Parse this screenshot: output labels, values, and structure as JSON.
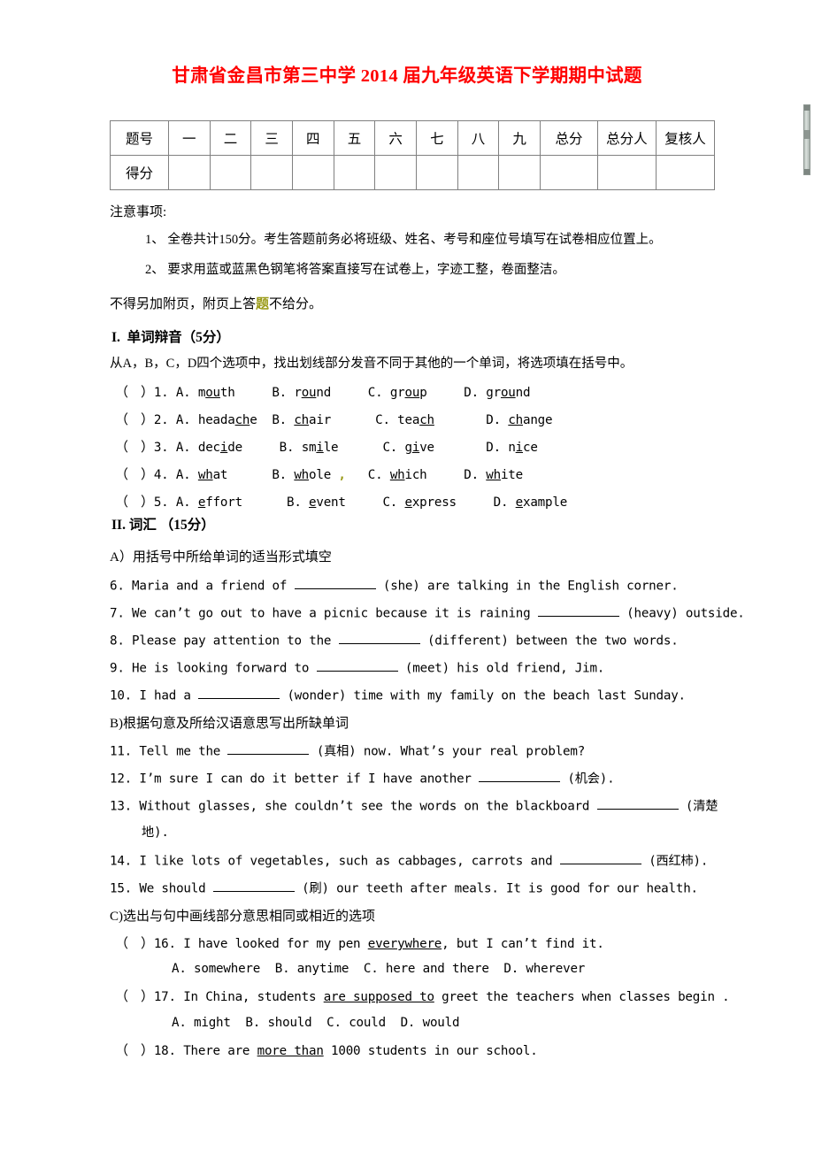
{
  "title": "甘肃省金昌市第三中学 2014 届九年级英语下学期期中试题",
  "score_table": {
    "row_labels": [
      "题号",
      "得分"
    ],
    "columns": [
      "一",
      "二",
      "三",
      "四",
      "五",
      "六",
      "七",
      "八",
      "九",
      "总分",
      "总分人",
      "复核人"
    ]
  },
  "notice": {
    "heading": "注意事项:",
    "item1": "1、 全卷共计150分。考生答题前务必将班级、姓名、考号和座位号填写在试卷相应位置上。",
    "item2": "2、 要求用蓝或蓝黑色钢笔将答案直接写在试卷上，字迹工整，卷面整洁。",
    "footer_a": "不得另加附页，附页上答",
    "footer_mark": "题",
    "footer_b": "不给分。"
  },
  "section1": {
    "heading": "I.  单词辩音（5分）",
    "instruction": "从A，B，C，D四个选项中，找出划线部分发音不同于其他的一个单词，将选项填在括号中。",
    "bracket": "（    ）",
    "questions": [
      {
        "num": "1.",
        "options": [
          {
            "letter": "A.",
            "pre": "m",
            "mid": "ou",
            "post": "th"
          },
          {
            "letter": "B.",
            "pre": "r",
            "mid": "ou",
            "post": "nd"
          },
          {
            "letter": "C.",
            "pre": "gr",
            "mid": "ou",
            "post": "p"
          },
          {
            "letter": "D.",
            "pre": "gr",
            "mid": "ou",
            "post": "nd"
          }
        ]
      },
      {
        "num": "2.",
        "options": [
          {
            "letter": "A.",
            "pre": "heada",
            "mid": "ch",
            "post": "e"
          },
          {
            "letter": "B.",
            "pre": "",
            "mid": "ch",
            "post": "air"
          },
          {
            "letter": "C.",
            "pre": "tea",
            "mid": "ch",
            "post": ""
          },
          {
            "letter": "D.",
            "pre": "",
            "mid": "ch",
            "post": "ange"
          }
        ]
      },
      {
        "num": "3.",
        "options": [
          {
            "letter": "A.",
            "pre": "dec",
            "mid": "i",
            "post": "de"
          },
          {
            "letter": "B.",
            "pre": "sm",
            "mid": "i",
            "post": "le"
          },
          {
            "letter": "C.",
            "pre": "g",
            "mid": "i",
            "post": "ve"
          },
          {
            "letter": "D.",
            "pre": "n",
            "mid": "i",
            "post": "ce"
          }
        ]
      },
      {
        "num": "4.",
        "options": [
          {
            "letter": "A.",
            "pre": "",
            "mid": "wh",
            "post": "at"
          },
          {
            "letter": "B.",
            "pre": "",
            "mid": "wh",
            "post": "ole"
          },
          {
            "letter": "C.",
            "pre": "",
            "mid": "wh",
            "post": "ich"
          },
          {
            "letter": "D.",
            "pre": "",
            "mid": "wh",
            "post": "ite"
          }
        ]
      },
      {
        "num": "5.",
        "options": [
          {
            "letter": "A.",
            "pre": "",
            "mid": "e",
            "post": "ffort"
          },
          {
            "letter": "B.",
            "pre": "",
            "mid": "e",
            "post": "vent"
          },
          {
            "letter": "C.",
            "pre": "",
            "mid": "e",
            "post": "xpress"
          },
          {
            "letter": "D.",
            "pre": "",
            "mid": "e",
            "post": "xample"
          }
        ]
      }
    ]
  },
  "section2": {
    "heading": "II. 词汇 （15分）",
    "partA_heading": "A）用括号中所给单词的适当形式填空",
    "partA": [
      {
        "num": "6.",
        "before": "Maria and a friend of ",
        "after": " (she) are talking in the English corner."
      },
      {
        "num": "7.",
        "before": "We can’t go out to have a picnic because it is raining ",
        "after": " (heavy) outside."
      },
      {
        "num": "8.",
        "before": "Please pay attention to the ",
        "after": " (different) between the two words."
      },
      {
        "num": "9.",
        "before": "He is looking forward to ",
        "after": " (meet) his old friend, Jim."
      },
      {
        "num": "10.",
        "before": "I had a ",
        "after": " (wonder) time with my family on the beach last Sunday."
      }
    ],
    "partB_heading": "B)根据句意及所给汉语意思写出所缺单词",
    "partB": [
      {
        "num": "11.",
        "before": "Tell me the ",
        "after": " (真相) now. What’s your real problem?",
        "after2": ""
      },
      {
        "num": "12.",
        "before": "I’m sure I can do it better if I have another ",
        "after": " (机会).",
        "after2": ""
      },
      {
        "num": "13.",
        "before": "Without glasses, she couldn’t see the words on the blackboard ",
        "after": " (清楚",
        "after2": "地)."
      },
      {
        "num": "14.",
        "before": "I like lots of vegetables, such as cabbages, carrots and ",
        "after": " (西红柿).",
        "after2": ""
      },
      {
        "num": "15.",
        "before": "We should ",
        "after": " (刷) our teeth after meals. It is good for our health.",
        "after2": ""
      }
    ],
    "partC_heading": "C)选出与句中画线部分意思相同或相近的选项",
    "partC": [
      {
        "bracket": "（    ）",
        "num": "16.",
        "stem_pre": "I have looked for my pen ",
        "stem_u": "everywhere",
        "stem_post": ", but I can’t find it.",
        "options": "A. somewhere  B. anytime  C. here and there  D. wherever"
      },
      {
        "bracket": "（    ）",
        "num": "17.",
        "stem_pre": "In China, students ",
        "stem_u": "are supposed to",
        "stem_post": " greet the teachers when classes begin .",
        "options": "A. might  B. should  C. could  D. would"
      },
      {
        "bracket": "（    ）",
        "num": "18.",
        "stem_pre": "There are ",
        "stem_u": "more than",
        "stem_post": " 1000 students in our school.",
        "options": ""
      }
    ]
  }
}
